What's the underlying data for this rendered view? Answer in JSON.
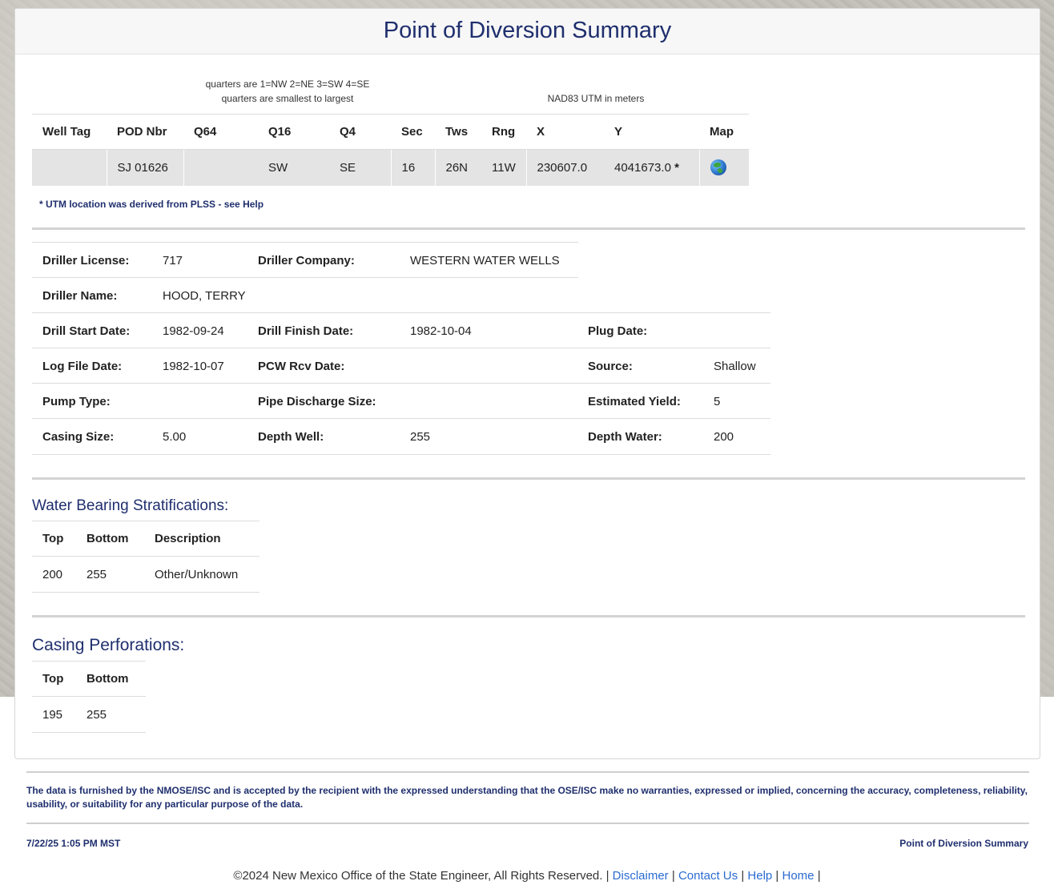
{
  "page_title": "Point of Diversion Summary",
  "quarters_note_1": "quarters are 1=NW 2=NE 3=SW 4=SE",
  "quarters_note_2": "quarters are smallest to largest",
  "utm_note_header": "NAD83 UTM in meters",
  "pod_table": {
    "headers": [
      "Well Tag",
      "POD Nbr",
      "Q64",
      "Q16",
      "Q4",
      "Sec",
      "Tws",
      "Rng",
      "X",
      "Y",
      "Map"
    ],
    "row": {
      "well_tag": "",
      "pod_nbr": "SJ 01626",
      "q64": "",
      "q16": "SW",
      "q4": "SE",
      "sec": "16",
      "tws": "26N",
      "rng": "11W",
      "x": "230607.0",
      "y": "4041673.0",
      "y_flag": "*",
      "map_icon": "globe-icon"
    }
  },
  "utm_derived_note": "* UTM location was derived from PLSS - see Help",
  "details": {
    "driller_license_label": "Driller License:",
    "driller_license": "717",
    "driller_company_label": "Driller Company:",
    "driller_company": "WESTERN WATER WELLS",
    "driller_name_label": "Driller Name:",
    "driller_name": "HOOD, TERRY",
    "drill_start_label": "Drill Start Date:",
    "drill_start": "1982-09-24",
    "drill_finish_label": "Drill Finish Date:",
    "drill_finish": "1982-10-04",
    "plug_date_label": "Plug Date:",
    "plug_date": "",
    "log_file_label": "Log File Date:",
    "log_file": "1982-10-07",
    "pcw_rcv_label": "PCW Rcv Date:",
    "pcw_rcv": "",
    "source_label": "Source:",
    "source": "Shallow",
    "pump_type_label": "Pump Type:",
    "pump_type": "",
    "pipe_discharge_label": "Pipe Discharge Size:",
    "pipe_discharge": "",
    "estimated_yield_label": "Estimated Yield:",
    "estimated_yield": "5",
    "casing_size_label": "Casing Size:",
    "casing_size": "5.00",
    "depth_well_label": "Depth Well:",
    "depth_well": "255",
    "depth_water_label": "Depth Water:",
    "depth_water": "200"
  },
  "stratifications": {
    "title": "Water Bearing Stratifications:",
    "headers": [
      "Top",
      "Bottom",
      "Description"
    ],
    "rows": [
      [
        "200",
        "255",
        "Other/Unknown"
      ]
    ]
  },
  "perforations": {
    "title": "Casing Perforations:",
    "headers": [
      "Top",
      "Bottom"
    ],
    "rows": [
      [
        "195",
        "255"
      ]
    ]
  },
  "footer": {
    "disclaimer": "The data is furnished by the NMOSE/ISC and is accepted by the recipient with the expressed understanding that the OSE/ISC make no warranties, expressed or implied, concerning the accuracy, completeness, reliability, usability, or suitability for any particular purpose of the data.",
    "timestamp": "7/22/25 1:05 PM MST",
    "page_name": "Point of Diversion Summary",
    "copyright": "©2024 New Mexico Office of the State Engineer, All Rights Reserved.",
    "sep": "|",
    "links": [
      "Disclaimer",
      "Contact Us",
      "Help",
      "Home"
    ]
  }
}
